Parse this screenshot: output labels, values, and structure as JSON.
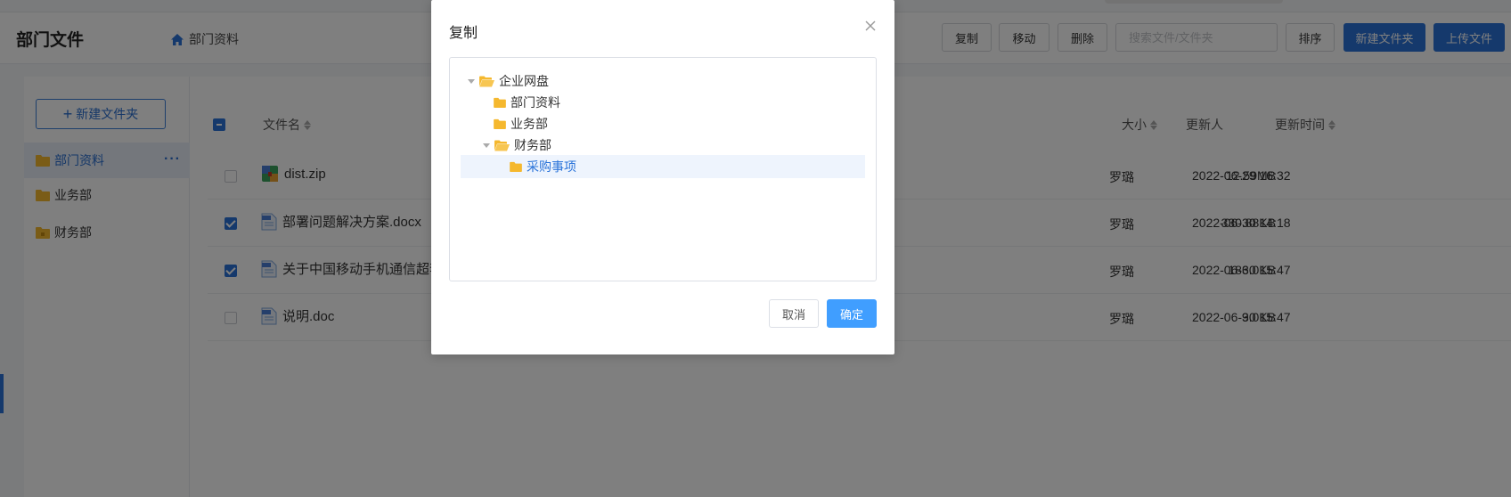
{
  "header": {
    "title": "部门文件",
    "breadcrumb": "部门资料",
    "buttons": {
      "copy": "复制",
      "move": "移动",
      "delete": "删除",
      "sort": "排序",
      "new_folder": "新建文件夹",
      "upload": "上传文件"
    },
    "search_placeholder": "搜索文件/文件夹"
  },
  "sidebar": {
    "new_folder_label": "新建文件夹",
    "items": [
      {
        "label": "部门资料",
        "active": true
      },
      {
        "label": "业务部",
        "active": false
      },
      {
        "label": "财务部",
        "active": false
      }
    ],
    "more_glyph": "···"
  },
  "table": {
    "columns": {
      "name": "文件名",
      "size": "大小",
      "updater": "更新人",
      "updated_at": "更新时间"
    },
    "rows": [
      {
        "name": "dist.zip",
        "size": "12.59MB",
        "updater": "罗璐",
        "time": "2022-06-29 16:32",
        "checked": false,
        "type": "zip"
      },
      {
        "name": "部署问题解决方案.docx",
        "size": "330.88KB",
        "updater": "罗璐",
        "time": "2022-06-30 14:18",
        "checked": true,
        "type": "doc"
      },
      {
        "name": "关于中国移动手机通信超套",
        "size": "186.0KB",
        "updater": "罗璐",
        "time": "2022-06-30 15:47",
        "checked": true,
        "type": "doc"
      },
      {
        "name": "说明.doc",
        "size": "9.0KB",
        "updater": "罗璐",
        "time": "2022-06-30 15:47",
        "checked": false,
        "type": "doc"
      }
    ]
  },
  "dialog": {
    "title": "复制",
    "tree": [
      {
        "label": "企业网盘",
        "level": 0,
        "expanded": true,
        "selected": false
      },
      {
        "label": "部门资料",
        "level": 1,
        "expanded": false,
        "selected": false
      },
      {
        "label": "业务部",
        "level": 1,
        "expanded": false,
        "selected": false
      },
      {
        "label": "财务部",
        "level": 1,
        "expanded": true,
        "selected": false
      },
      {
        "label": "采购事项",
        "level": 2,
        "expanded": false,
        "selected": true
      }
    ],
    "cancel_label": "取消",
    "ok_label": "确定"
  },
  "colors": {
    "primary": "#2a73d9",
    "dialog_primary": "#409eff",
    "folder": "#f5b82e",
    "overlay": "rgba(0,0,0,0.5)"
  }
}
